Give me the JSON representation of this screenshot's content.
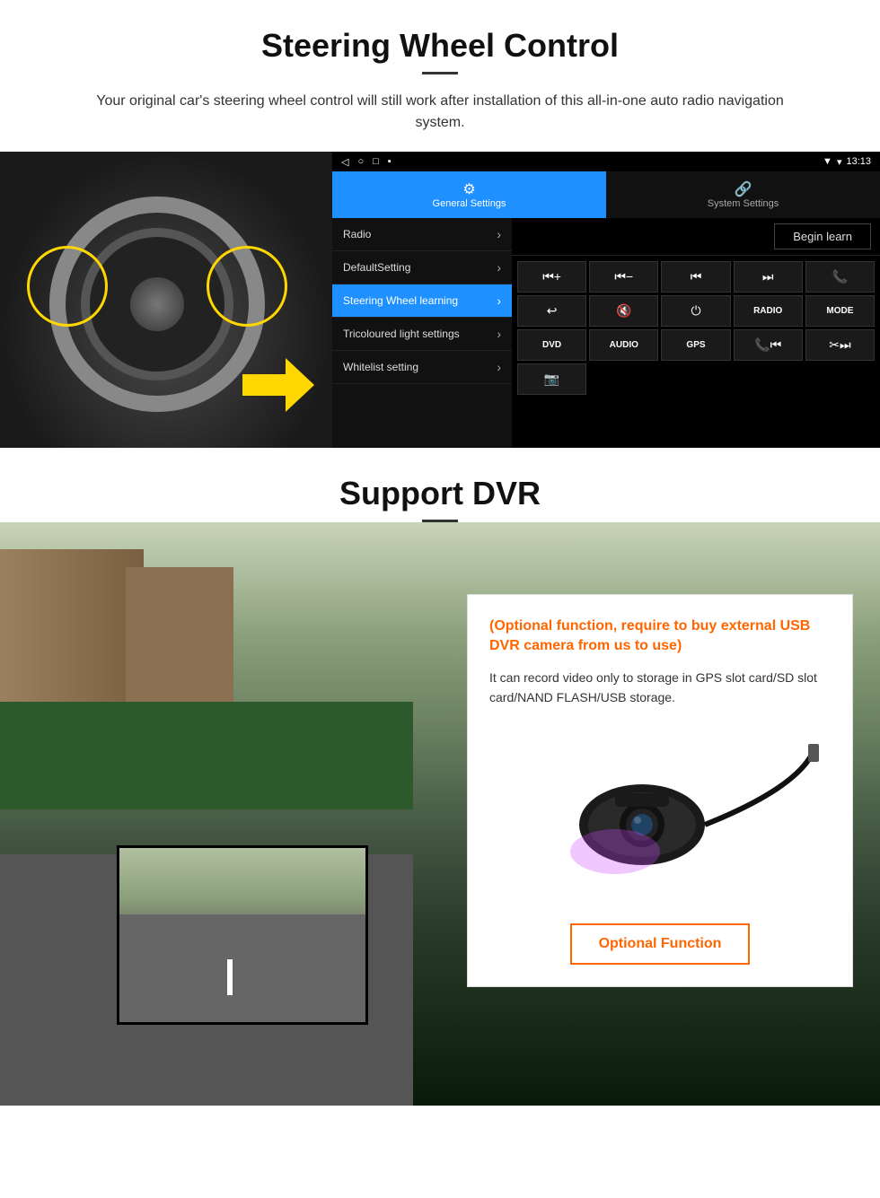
{
  "section1": {
    "title": "Steering Wheel Control",
    "description": "Your original car's steering wheel control will still work after installation of this all-in-one auto radio navigation system.",
    "android": {
      "statusbar": {
        "time": "13:13",
        "nav_back": "◁",
        "nav_home": "○",
        "nav_square": "□",
        "nav_menu": "▪"
      },
      "tabs": {
        "general_icon": "⚙",
        "general_label": "General Settings",
        "system_icon": "🔗",
        "system_label": "System Settings"
      },
      "menu_items": [
        {
          "label": "Radio",
          "active": false
        },
        {
          "label": "DefaultSetting",
          "active": false
        },
        {
          "label": "Steering Wheel learning",
          "active": true
        },
        {
          "label": "Tricoloured light settings",
          "active": false
        },
        {
          "label": "Whitelist setting",
          "active": false
        }
      ],
      "begin_learn": "Begin learn",
      "control_buttons": [
        "⏮+",
        "⏮-",
        "⏮",
        "⏭",
        "📞",
        "↩",
        "🔇",
        "⏻",
        "RADIO",
        "MODE",
        "DVD",
        "AUDIO",
        "GPS",
        "📞⏮",
        "✂⏭",
        "📷"
      ]
    }
  },
  "section2": {
    "title": "Support DVR",
    "optional_header": "(Optional function, require to buy external USB DVR camera from us to use)",
    "description": "It can record video only to storage in GPS slot card/SD slot card/NAND FLASH/USB storage.",
    "optional_function_label": "Optional Function"
  }
}
